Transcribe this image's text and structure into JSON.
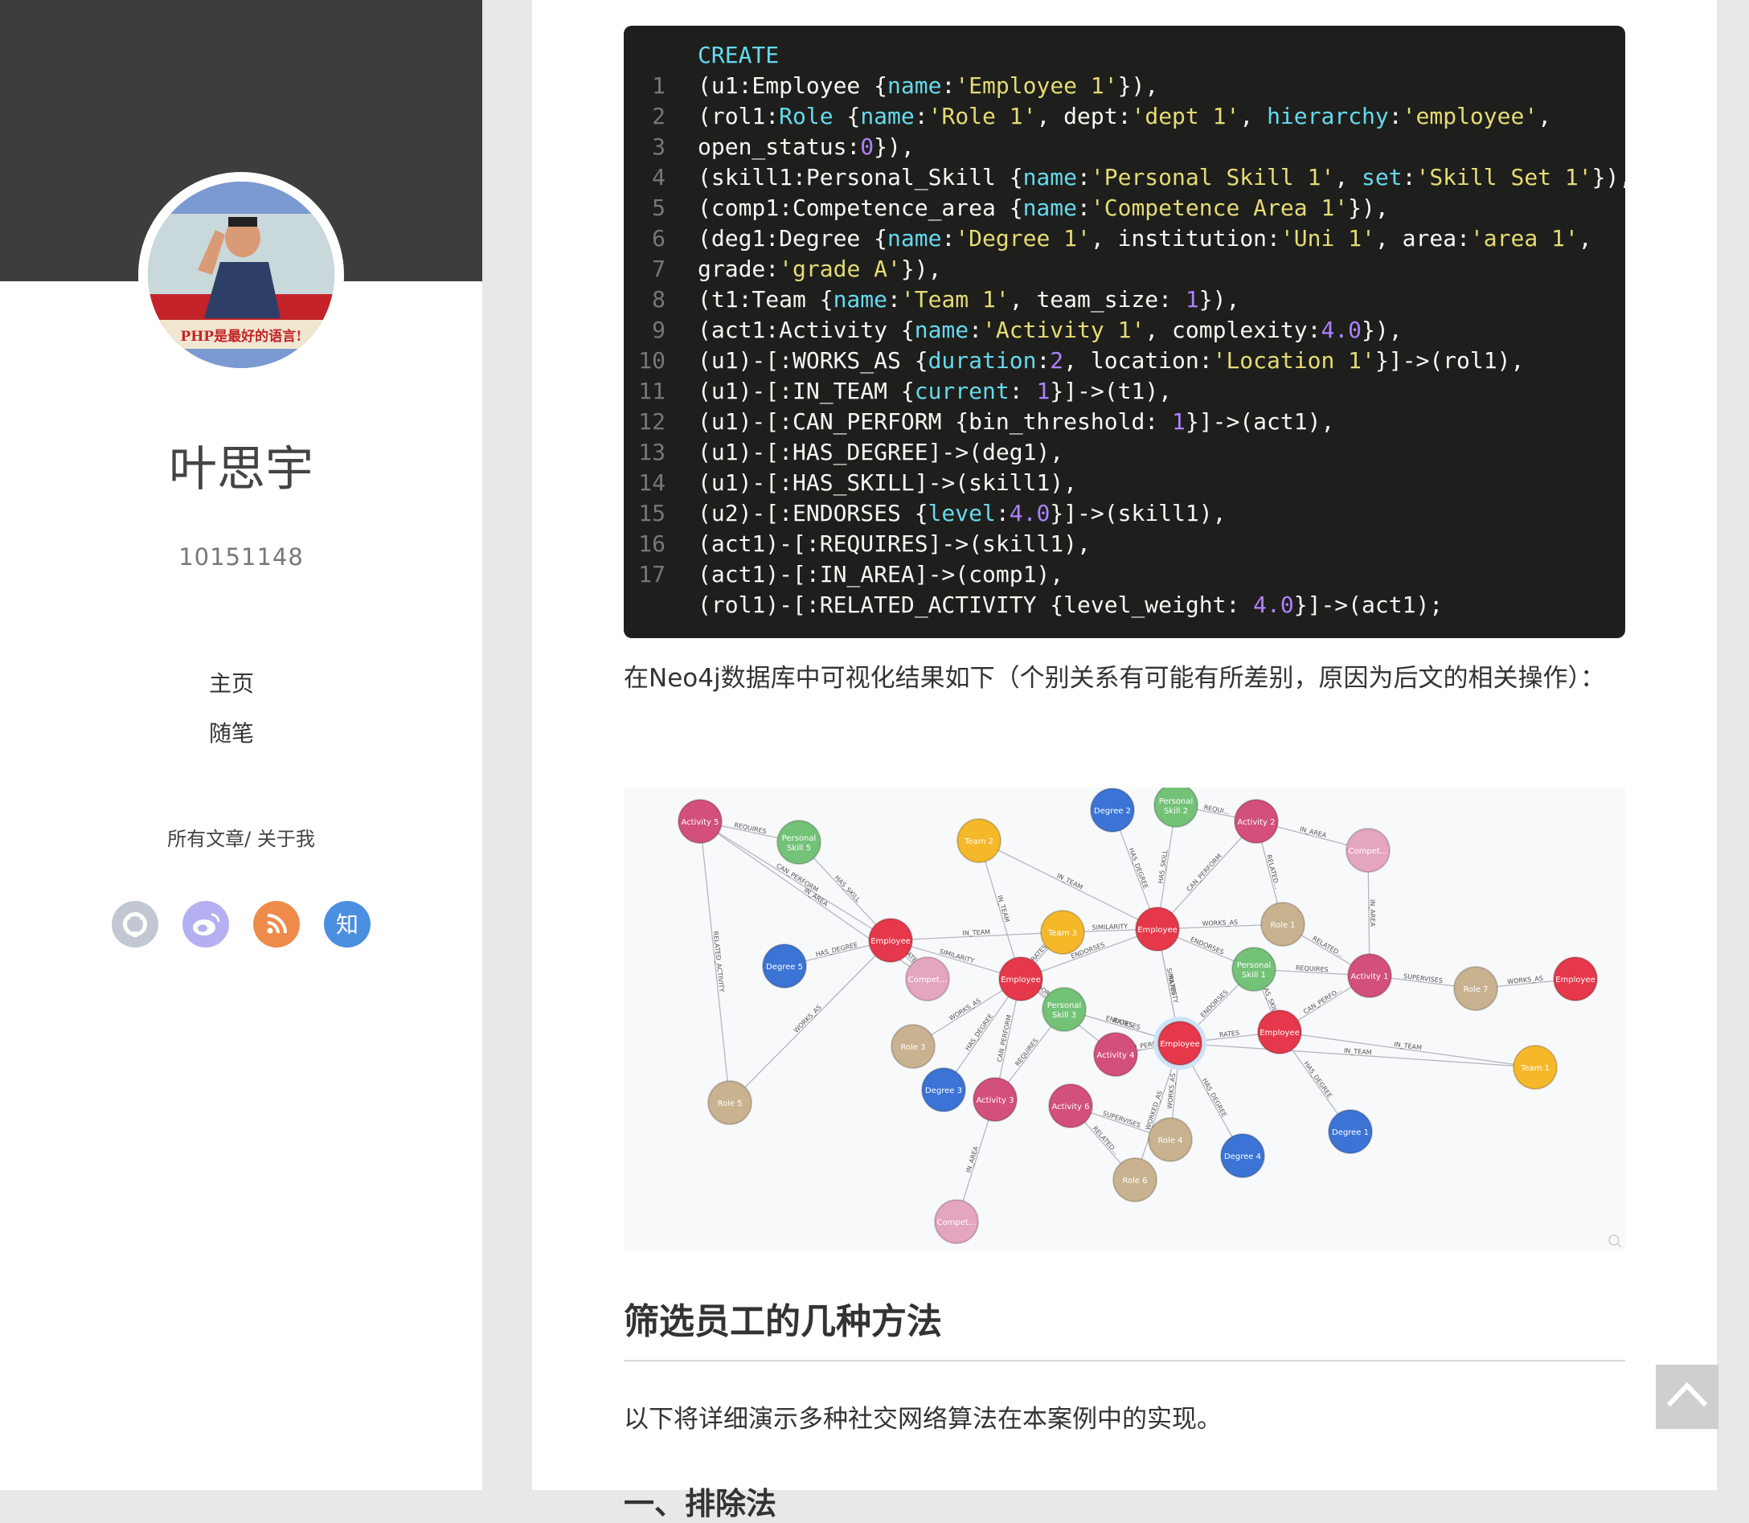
{
  "author": {
    "name": "叶思宇",
    "id": "10151148"
  },
  "avatar": {
    "caption": "PHP是最好的语言!"
  },
  "nav": {
    "home": "主页",
    "essays": "随笔"
  },
  "links": {
    "all_posts": "所有文章",
    "separator": "/ ",
    "about": "关于我"
  },
  "social": [
    {
      "icon": "github-icon",
      "color": "#c2c7d3"
    },
    {
      "icon": "weibo-icon",
      "color": "#b4b0f1",
      "glyph": "◉"
    },
    {
      "icon": "rss-icon",
      "color": "#ee8b4a"
    },
    {
      "icon": "zhihu-icon",
      "color": "#4b8fe0",
      "glyph": "知"
    }
  ],
  "code": {
    "lines": [
      {
        "no": "",
        "html": "<span class=\"k\">CREATE</span>"
      },
      {
        "no": "1",
        "html": "(u1:Employee {<span class=\"k\">name</span>:<span class=\"s\">'Employee 1'</span>}),"
      },
      {
        "no": "2",
        "html": "(rol1:<span class=\"k\">Role</span> {<span class=\"k\">name</span>:<span class=\"s\">'Role 1'</span>, dept:<span class=\"s\">'dept 1'</span>, <span class=\"k\">hierarchy</span>:<span class=\"s\">'employee'</span>,"
      },
      {
        "no": "3",
        "html": "open_status:<span class=\"n\">0</span>}),"
      },
      {
        "no": "4",
        "html": "(skill1:Personal_Skill {<span class=\"k\">name</span>:<span class=\"s\">'Personal Skill 1'</span>, <span class=\"k\">set</span>:<span class=\"s\">'Skill Set 1'</span>}),"
      },
      {
        "no": "5",
        "html": "(comp1:Competence_area {<span class=\"k\">name</span>:<span class=\"s\">'Competence Area 1'</span>}),"
      },
      {
        "no": "6",
        "html": "(deg1:Degree {<span class=\"k\">name</span>:<span class=\"s\">'Degree 1'</span>, institution:<span class=\"s\">'Uni 1'</span>, area:<span class=\"s\">'area 1'</span>,"
      },
      {
        "no": "7",
        "html": "grade:<span class=\"s\">'grade A'</span>}),"
      },
      {
        "no": "8",
        "html": "(t1:Team {<span class=\"k\">name</span>:<span class=\"s\">'Team 1'</span>, team_size: <span class=\"n\">1</span>}),"
      },
      {
        "no": "9",
        "html": "(act1:Activity {<span class=\"k\">name</span>:<span class=\"s\">'Activity 1'</span>, complexity:<span class=\"n\">4.0</span>}),"
      },
      {
        "no": "10",
        "html": "(u1)-[:WORKS_AS {<span class=\"k\">duration</span>:<span class=\"n\">2</span>, location:<span class=\"s\">'Location 1'</span>}]->(rol1),"
      },
      {
        "no": "11",
        "html": "(u1)-[:IN_TEAM {<span class=\"k\">current</span>: <span class=\"n\">1</span>}]->(t1),"
      },
      {
        "no": "12",
        "html": "(u1)-[:CAN_PERFORM {bin_threshold: <span class=\"n\">1</span>}]->(act1),"
      },
      {
        "no": "13",
        "html": "(u1)-[:HAS_DEGREE]->(deg1),"
      },
      {
        "no": "14",
        "html": "(u1)-[:HAS_SKILL]->(skill1),"
      },
      {
        "no": "15",
        "html": "(u2)-[:ENDORSES {<span class=\"k\">level</span>:<span class=\"n\">4.0</span>}]->(skill1),"
      },
      {
        "no": "16",
        "html": "(act1)-[:REQUIRES]->(skill1),"
      },
      {
        "no": "17",
        "html": "(act1)-[:IN_AREA]->(comp1),"
      },
      {
        "no": "",
        "html": "(rol1)-[:RELATED_ACTIVITY {level_weight: <span class=\"n\">4.0</span>}]->(act1);"
      }
    ]
  },
  "paragraph1": "在Neo4j数据库中可视化结果如下（个别关系有可能有所差别，原因为后文的相关操作）：",
  "graph": {
    "colors": {
      "Activity": "#d2507a",
      "Skill": "#73c277",
      "Team": "#f5b829",
      "Employee": "#e5384a",
      "Degree": "#3b74d4",
      "Role": "#c9b28f",
      "Compet": "#e4a5bf"
    },
    "nodes": [
      {
        "id": "act5",
        "label": "Activity 5",
        "type": "Activity"
      },
      {
        "id": "ps5",
        "label": "Personal Skill 5",
        "type": "Skill"
      },
      {
        "id": "team2",
        "label": "Team 2",
        "type": "Team"
      },
      {
        "id": "deg2",
        "label": "Degree 2",
        "type": "Degree"
      },
      {
        "id": "ps2",
        "label": "Personal Skill 2",
        "type": "Skill"
      },
      {
        "id": "act2",
        "label": "Activity 2",
        "type": "Activity"
      },
      {
        "id": "compA",
        "label": "Compet...",
        "type": "Compet"
      },
      {
        "id": "emp1",
        "label": "Employee",
        "type": "Employee"
      },
      {
        "id": "team3",
        "label": "Team 3",
        "type": "Team"
      },
      {
        "id": "emp2",
        "label": "Employee",
        "type": "Employee"
      },
      {
        "id": "role1",
        "label": "Role 1",
        "type": "Role"
      },
      {
        "id": "deg5",
        "label": "Degree 5",
        "type": "Degree"
      },
      {
        "id": "compB",
        "label": "Compet...",
        "type": "Compet"
      },
      {
        "id": "emp3",
        "label": "Employee",
        "type": "Employee"
      },
      {
        "id": "ps1",
        "label": "Personal Skill 1",
        "type": "Skill"
      },
      {
        "id": "act1",
        "label": "Activity 1",
        "type": "Activity"
      },
      {
        "id": "role7",
        "label": "Role 7",
        "type": "Role"
      },
      {
        "id": "emp4",
        "label": "Employee",
        "type": "Employee"
      },
      {
        "id": "ps3",
        "label": "Personal Skill 3",
        "type": "Skill"
      },
      {
        "id": "role3",
        "label": "Role 3",
        "type": "Role"
      },
      {
        "id": "act4",
        "label": "Activity 4",
        "type": "Activity"
      },
      {
        "id": "emp5",
        "label": "Employee",
        "type": "Employee"
      },
      {
        "id": "emp6",
        "label": "Employee",
        "type": "Employee"
      },
      {
        "id": "team1",
        "label": "Team 1",
        "type": "Team"
      },
      {
        "id": "deg3",
        "label": "Degree 3",
        "type": "Degree"
      },
      {
        "id": "act3",
        "label": "Activity 3",
        "type": "Activity"
      },
      {
        "id": "act6",
        "label": "Activity 6",
        "type": "Activity"
      },
      {
        "id": "role4",
        "label": "Role 4",
        "type": "Role"
      },
      {
        "id": "deg4",
        "label": "Degree 4",
        "type": "Degree"
      },
      {
        "id": "deg1",
        "label": "Degree 1",
        "type": "Degree"
      },
      {
        "id": "role5",
        "label": "Role 5",
        "type": "Role"
      },
      {
        "id": "role6",
        "label": "Role 6",
        "type": "Role"
      },
      {
        "id": "compC",
        "label": "Compet...",
        "type": "Compet"
      }
    ],
    "edges": [
      {
        "from": "act5",
        "to": "ps5",
        "label": "REQUIRES"
      },
      {
        "from": "emp1",
        "to": "ps5",
        "label": "HAS_SKILL"
      },
      {
        "from": "act5",
        "to": "emp1",
        "label": "CAN_PERFORM"
      },
      {
        "from": "act5",
        "to": "compB",
        "label": "IN_AREA"
      },
      {
        "from": "role5",
        "to": "act5",
        "label": "RELATED_ACTIVITY"
      },
      {
        "from": "role5",
        "to": "emp1",
        "label": "WORKS_AS"
      },
      {
        "from": "emp1",
        "to": "deg5",
        "label": "HAS_DEGREE"
      },
      {
        "from": "emp1",
        "to": "team3",
        "label": "IN_TEAM"
      },
      {
        "from": "emp1",
        "to": "emp3",
        "label": "SIMILARITY"
      },
      {
        "from": "emp1",
        "to": "compB",
        "label": "RATES"
      },
      {
        "from": "emp3",
        "to": "team2",
        "label": "IN_TEAM"
      },
      {
        "from": "emp2",
        "to": "team2",
        "label": "IN_TEAM"
      },
      {
        "from": "emp2",
        "to": "team3",
        "label": "SIMILARITY"
      },
      {
        "from": "emp2",
        "to": "deg2",
        "label": "HAS_DEGREE"
      },
      {
        "from": "emp2",
        "to": "ps2",
        "label": "HAS_SKILL"
      },
      {
        "from": "emp2",
        "to": "act2",
        "label": "CAN_PERFORM"
      },
      {
        "from": "ps2",
        "to": "act2",
        "label": "REQUI..."
      },
      {
        "from": "act2",
        "to": "compA",
        "label": "IN_AREA"
      },
      {
        "from": "act2",
        "to": "role1",
        "label": "RELATED..."
      },
      {
        "from": "emp2",
        "to": "role1",
        "label": "WORKS_AS"
      },
      {
        "from": "emp2",
        "to": "ps1",
        "label": "ENDORSES"
      },
      {
        "from": "emp2",
        "to": "emp5",
        "label": "SIMILARITY"
      },
      {
        "from": "role1",
        "to": "act1",
        "label": "RELATED..."
      },
      {
        "from": "act1",
        "to": "ps1",
        "label": "REQUIRES"
      },
      {
        "from": "act1",
        "to": "compA",
        "label": "IN_AREA"
      },
      {
        "from": "role7",
        "to": "act1",
        "label": "SUPERVISES"
      },
      {
        "from": "emp4",
        "to": "role7",
        "label": "WORKS_AS"
      },
      {
        "from": "emp6",
        "to": "act1",
        "label": "CAN_PERFO..."
      },
      {
        "from": "emp6",
        "to": "ps1",
        "label": "HAS_SKILL"
      },
      {
        "from": "emp6",
        "to": "team1",
        "label": "IN_TEAM"
      },
      {
        "from": "emp6",
        "to": "deg1",
        "label": "HAS_DEGREE"
      },
      {
        "from": "emp5",
        "to": "team1",
        "label": "IN_TEAM"
      },
      {
        "from": "emp5",
        "to": "emp6",
        "label": "RATES"
      },
      {
        "from": "emp5",
        "to": "ps3",
        "label": "ENDORSES"
      },
      {
        "from": "emp5",
        "to": "ps1",
        "label": "ENDORSES"
      },
      {
        "from": "emp5",
        "to": "act4",
        "label": "CAN_PERFORM"
      },
      {
        "from": "emp5",
        "to": "role4",
        "label": "WORKS_AS"
      },
      {
        "from": "emp5",
        "to": "deg4",
        "label": "HAS_DEGREE"
      },
      {
        "from": "emp5",
        "to": "role6",
        "label": "WORKED_AS"
      },
      {
        "from": "emp3",
        "to": "ps3",
        "label": "ENDORSES"
      },
      {
        "from": "emp3",
        "to": "emp2",
        "label": "ENDORSES"
      },
      {
        "from": "emp3",
        "to": "team3",
        "label": "RATES"
      },
      {
        "from": "emp3",
        "to": "act3",
        "label": "CAN_PERFORM"
      },
      {
        "from": "emp3",
        "to": "deg3",
        "label": "HAS_DEGREE"
      },
      {
        "from": "emp3",
        "to": "role3",
        "label": "WORKS_AS"
      },
      {
        "from": "emp3",
        "to": "act4",
        "label": "IN_AREA"
      },
      {
        "from": "act3",
        "to": "compC",
        "label": "IN_AREA"
      },
      {
        "from": "act3",
        "to": "ps3",
        "label": "REQUIRES"
      },
      {
        "from": "act6",
        "to": "role4",
        "label": "SUPERVISES"
      },
      {
        "from": "act6",
        "to": "role6",
        "label": "RELATED..."
      },
      {
        "from": "emp2",
        "to": "emp5",
        "label": "RATES"
      },
      {
        "from": "ps3",
        "to": "emp5",
        "label": "RATES"
      }
    ]
  },
  "heading": "筛选员工的几种方法",
  "paragraph2": "以下将详细演示多种社交网络算法在本案例中的实现。",
  "heading3": "一、排除法",
  "back_to_top": "back-to-top"
}
